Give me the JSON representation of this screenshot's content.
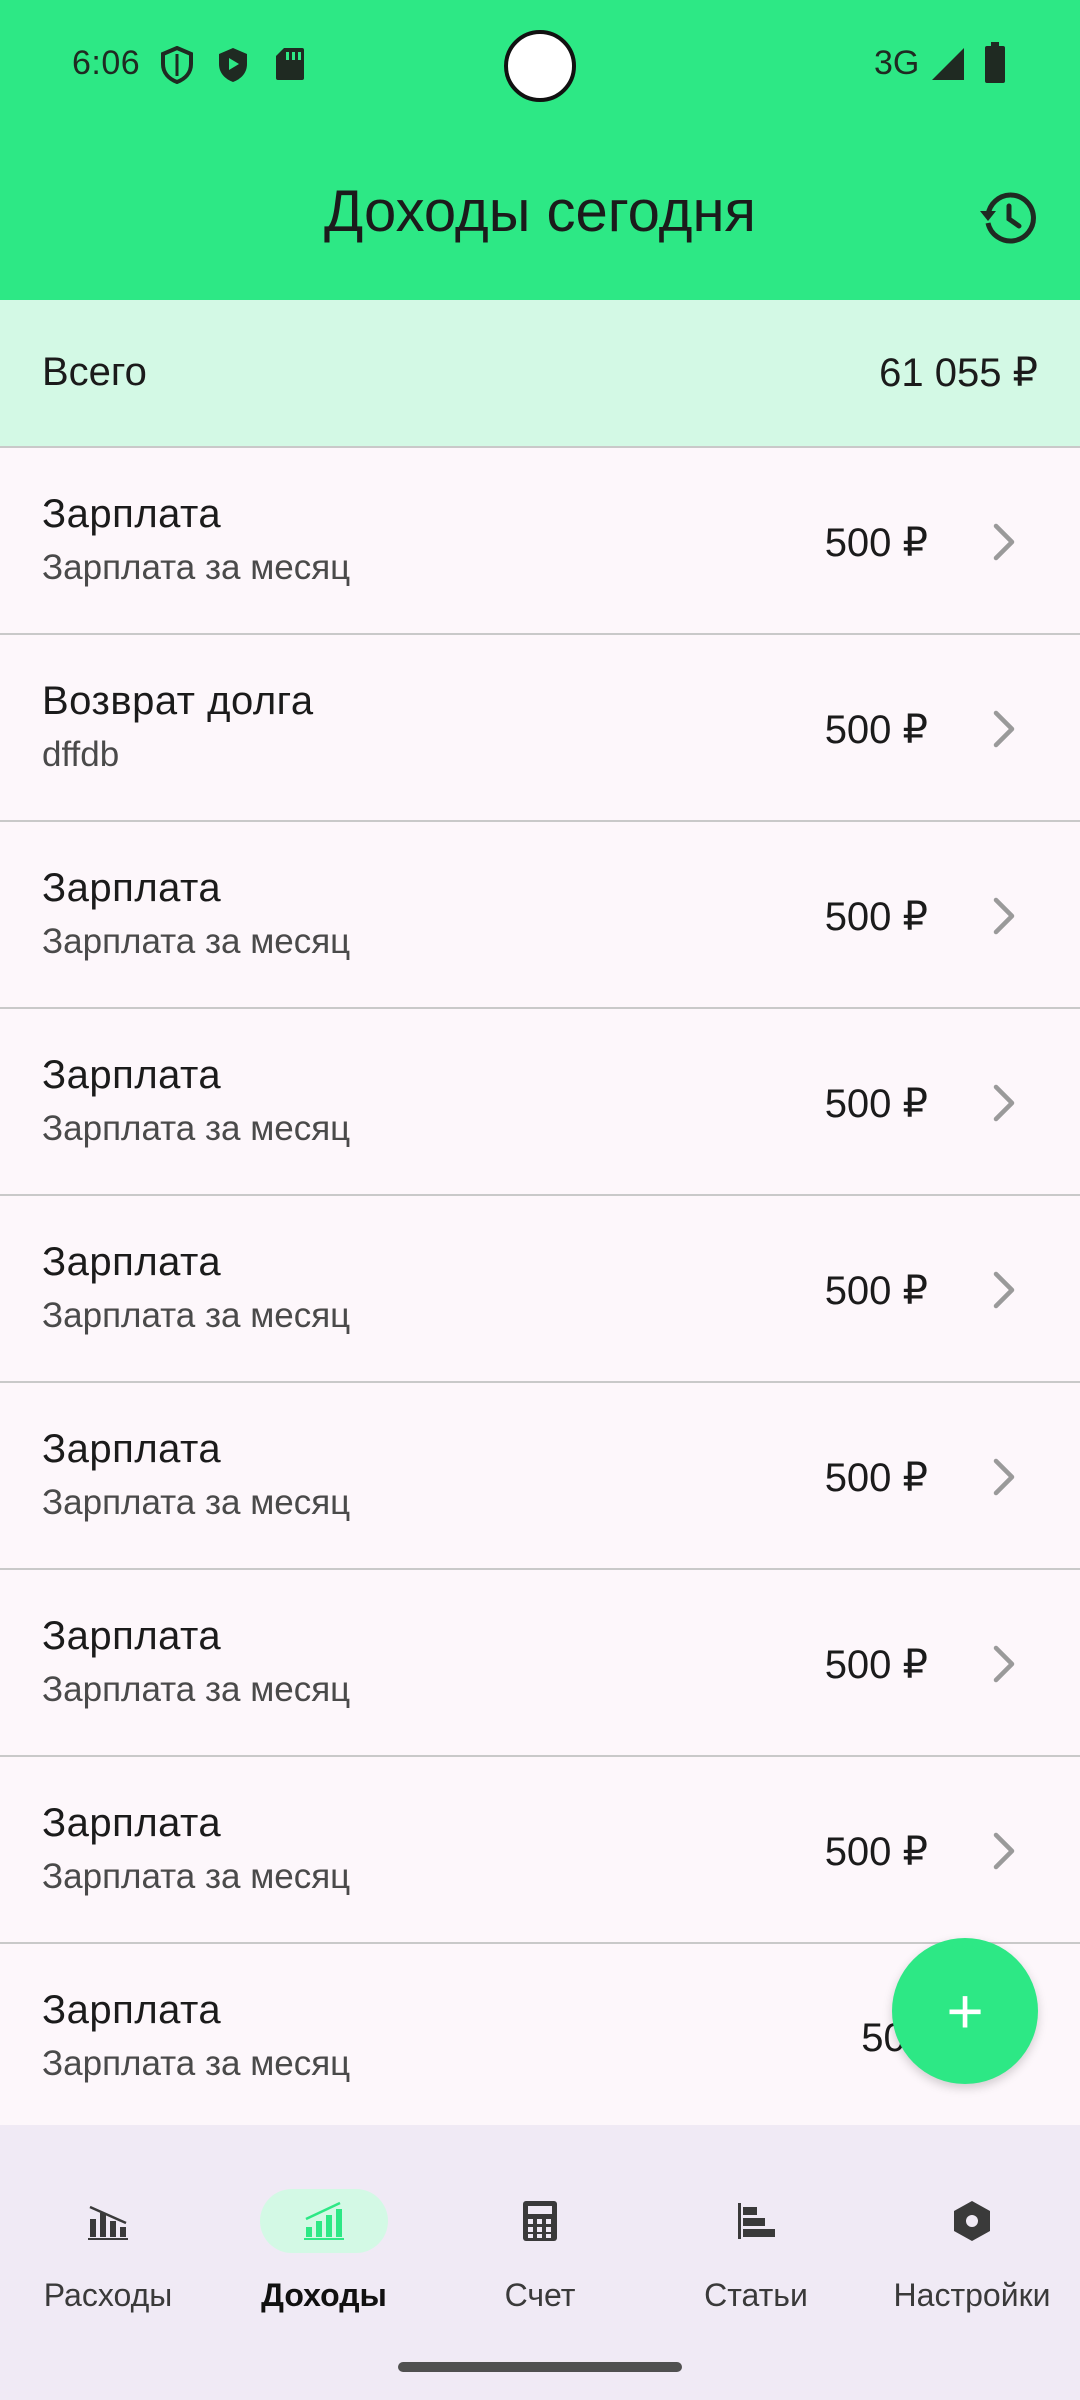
{
  "status_bar": {
    "time": "6:06",
    "network": "3G"
  },
  "app_bar": {
    "title": "Доходы сегодня",
    "history_icon": "history-icon"
  },
  "summary": {
    "label": "Всего",
    "value": "61 055 ₽"
  },
  "transactions": [
    {
      "title": "Зарплата",
      "subtitle": "Зарплата за месяц",
      "amount": "500 ₽"
    },
    {
      "title": "Возврат долга",
      "subtitle": "dffdb",
      "amount": "500 ₽"
    },
    {
      "title": "Зарплата",
      "subtitle": "Зарплата за месяц",
      "amount": "500 ₽"
    },
    {
      "title": "Зарплата",
      "subtitle": "Зарплата за месяц",
      "amount": "500 ₽"
    },
    {
      "title": "Зарплата",
      "subtitle": "Зарплата за месяц",
      "amount": "500 ₽"
    },
    {
      "title": "Зарплата",
      "subtitle": "Зарплата за месяц",
      "amount": "500 ₽"
    },
    {
      "title": "Зарплата",
      "subtitle": "Зарплата за месяц",
      "amount": "500 ₽"
    },
    {
      "title": "Зарплата",
      "subtitle": "Зарплата за месяц",
      "amount": "500 ₽"
    },
    {
      "title": "Зарплата",
      "subtitle": "Зарплата за месяц",
      "amount": "500"
    }
  ],
  "fab": {
    "label": "+"
  },
  "bottom_nav": [
    {
      "label": "Расходы",
      "icon": "expenses-chart-icon",
      "active": false
    },
    {
      "label": "Доходы",
      "icon": "income-chart-icon",
      "active": true
    },
    {
      "label": "Счет",
      "icon": "calculator-icon",
      "active": false
    },
    {
      "label": "Статьи",
      "icon": "bar-list-icon",
      "active": false
    },
    {
      "label": "Настройки",
      "icon": "settings-hexagon-icon",
      "active": false
    }
  ],
  "colors": {
    "primary": "#2de885",
    "summary_bg": "#d3f9e5",
    "nav_bg": "#f0eaf5",
    "list_bg": "#fdf7fb"
  }
}
